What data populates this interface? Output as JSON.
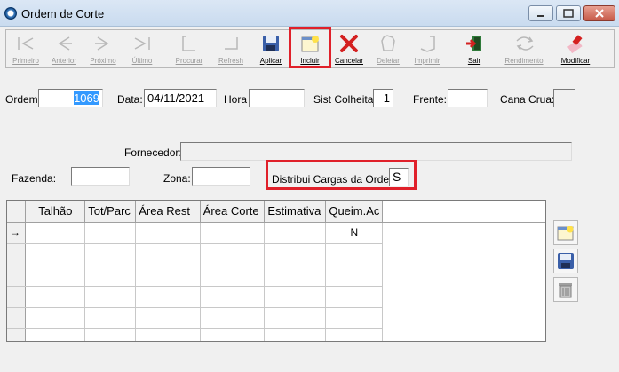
{
  "window": {
    "title": "Ordem de Corte"
  },
  "toolbar": {
    "buttons": [
      {
        "label": "Primeiro",
        "icon": "first-record-icon",
        "enabled": false
      },
      {
        "label": "Anterior",
        "icon": "previous-record-icon",
        "enabled": false
      },
      {
        "label": "Próximo",
        "icon": "next-record-icon",
        "enabled": false
      },
      {
        "label": "Último",
        "icon": "last-record-icon",
        "enabled": false
      },
      {
        "label": "Procurar",
        "icon": "search-icon",
        "enabled": false
      },
      {
        "label": "Refresh",
        "icon": "refresh-icon",
        "enabled": false
      },
      {
        "label": "Aplicar",
        "icon": "save-icon",
        "enabled": true
      },
      {
        "label": "Incluir",
        "icon": "new-record-icon",
        "enabled": true
      },
      {
        "label": "Cancelar",
        "icon": "cancel-icon",
        "enabled": true
      },
      {
        "label": "Deletar",
        "icon": "delete-icon",
        "enabled": false
      },
      {
        "label": "Imprimir",
        "icon": "print-icon",
        "enabled": false
      },
      {
        "label": "Sair",
        "icon": "exit-icon",
        "enabled": true
      },
      {
        "label": "Rendimento",
        "icon": "yield-icon",
        "enabled": false
      },
      {
        "label": "Modificar",
        "icon": "edit-icon",
        "enabled": true
      }
    ]
  },
  "form": {
    "ordem_label": "Ordem",
    "ordem_value": "1069",
    "data_label": "Data:",
    "data_value": "04/11/2021",
    "hora_label": "Hora",
    "hora_value": "",
    "sist_colheita_label": "Sist Colheita:",
    "sist_colheita_value": "1",
    "frente_label": "Frente:",
    "frente_value": "",
    "cana_crua_label": "Cana Crua:",
    "fornecedor_label": "Fornecedor:",
    "fornecedor_value": "",
    "fazenda_label": "Fazenda:",
    "fazenda_value": "",
    "zona_label": "Zona:",
    "zona_value": "",
    "distribui_label": "Distribui Cargas da Ordem:",
    "distribui_value": "S"
  },
  "grid": {
    "columns": [
      "Talhão",
      "Tot/Parc",
      "Área Rest",
      "Área Corte",
      "Estimativa",
      "Queim.Ac"
    ],
    "rows": [
      [
        "",
        "",
        "",
        "",
        "",
        "N"
      ],
      [
        "",
        "",
        "",
        "",
        "",
        ""
      ],
      [
        "",
        "",
        "",
        "",
        "",
        ""
      ],
      [
        "",
        "",
        "",
        "",
        "",
        ""
      ],
      [
        "",
        "",
        "",
        "",
        "",
        ""
      ],
      [
        "",
        "",
        "",
        "",
        "",
        ""
      ]
    ],
    "current_row_marker": "→"
  },
  "side_buttons": [
    {
      "icon": "new-record-icon"
    },
    {
      "icon": "save-icon"
    },
    {
      "icon": "trash-icon"
    }
  ],
  "colors": {
    "highlight": "#e0202a",
    "selection": "#3399ff"
  }
}
